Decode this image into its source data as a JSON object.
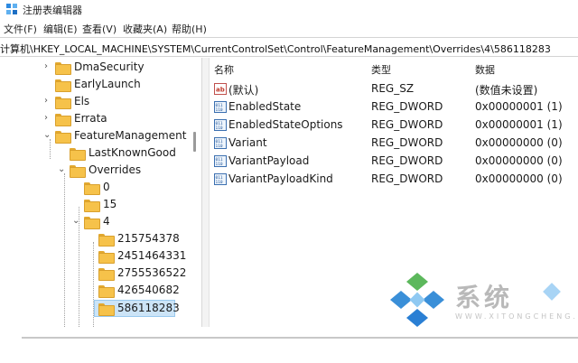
{
  "window": {
    "title": "注册表编辑器",
    "app_icon": "registry-editor-icon"
  },
  "menu": [
    {
      "label": "文件(F)"
    },
    {
      "label": "编辑(E)"
    },
    {
      "label": "查看(V)"
    },
    {
      "label": "收藏夹(A)"
    },
    {
      "label": "帮助(H)"
    }
  ],
  "address": "计算机\\HKEY_LOCAL_MACHINE\\SYSTEM\\CurrentControlSet\\Control\\FeatureManagement\\Overrides\\4\\586118283",
  "tree": [
    {
      "label": "DmaSecurity",
      "expander": "collapsed"
    },
    {
      "label": "EarlyLaunch",
      "expander": "none"
    },
    {
      "label": "Els",
      "expander": "collapsed"
    },
    {
      "label": "Errata",
      "expander": "collapsed"
    },
    {
      "label": "FeatureManagement",
      "expander": "expanded"
    },
    {
      "label": "LastKnownGood",
      "expander": "none"
    },
    {
      "label": "Overrides",
      "expander": "expanded"
    },
    {
      "label": "0",
      "expander": "none"
    },
    {
      "label": "15",
      "expander": "none"
    },
    {
      "label": "4",
      "expander": "expanded"
    },
    {
      "label": "215754378",
      "expander": "none"
    },
    {
      "label": "2451464331",
      "expander": "none"
    },
    {
      "label": "2755536522",
      "expander": "none"
    },
    {
      "label": "426540682",
      "expander": "none"
    },
    {
      "label": "586118283",
      "expander": "none",
      "selected": true
    }
  ],
  "columns": {
    "name": "名称",
    "type": "类型",
    "data": "数据"
  },
  "values": [
    {
      "name": "(默认)",
      "type": "REG_SZ",
      "data": "(数值未设置)",
      "icon": "string-value-icon"
    },
    {
      "name": "EnabledState",
      "type": "REG_DWORD",
      "data": "0x00000001 (1)",
      "icon": "dword-value-icon"
    },
    {
      "name": "EnabledStateOptions",
      "type": "REG_DWORD",
      "data": "0x00000001 (1)",
      "icon": "dword-value-icon"
    },
    {
      "name": "Variant",
      "type": "REG_DWORD",
      "data": "0x00000000 (0)",
      "icon": "dword-value-icon"
    },
    {
      "name": "VariantPayload",
      "type": "REG_DWORD",
      "data": "0x00000000 (0)",
      "icon": "dword-value-icon"
    },
    {
      "name": "VariantPayloadKind",
      "type": "REG_DWORD",
      "data": "0x00000000 (0)",
      "icon": "dword-value-icon"
    }
  ],
  "watermark": {
    "text": "系统",
    "sub": "WWW.XITONGCHENG.COM"
  },
  "colors": {
    "selection": "#cce4f7",
    "folder": "#f6c24a",
    "accent": "#2a7fd4"
  }
}
